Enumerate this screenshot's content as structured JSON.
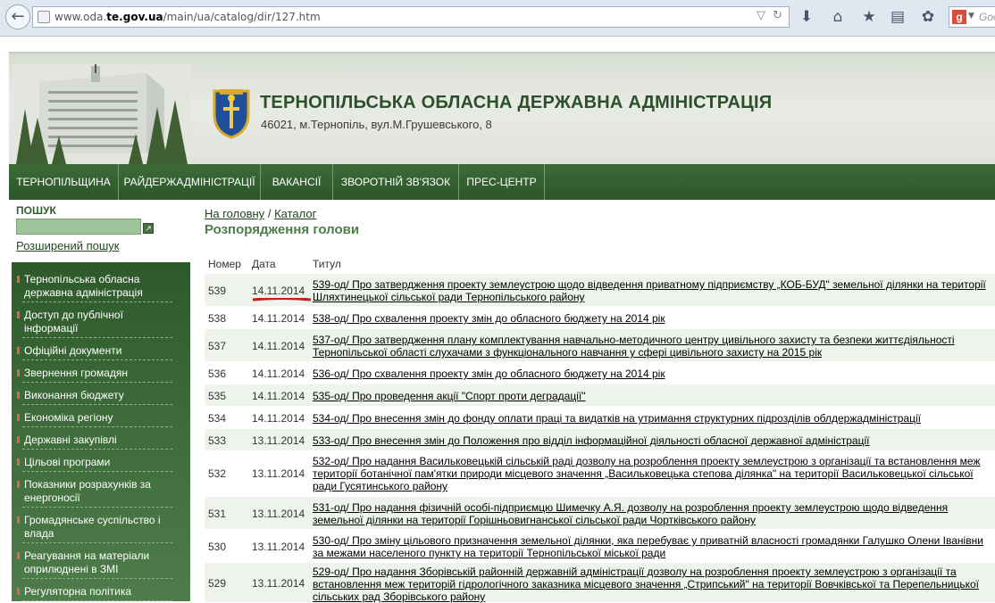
{
  "browser": {
    "url_prefix": "www.oda.",
    "url_domain": "te.gov.ua",
    "url_path": "/main/ua/catalog/dir/127.htm",
    "search_placeholder": "Goo",
    "accent_color": "#dd4b39"
  },
  "header": {
    "title": "ТЕРНОПІЛЬСЬКА ОБЛАСНА ДЕРЖАВНА АДМІНІСТРАЦІЯ",
    "address": "46021, м.Тернопіль, вул.М.Грушевського, 8",
    "brand_color": "#2d5629"
  },
  "menu": [
    {
      "label": "ТЕРНОПІЛЬЩИНА"
    },
    {
      "label": "РАЙДЕРЖАДМІНІСТРАЦІЇ"
    },
    {
      "label": "ВАКАНСІЇ"
    },
    {
      "label": "ЗВОРОТНІЙ ЗВ'ЯЗОК"
    },
    {
      "label": "ПРЕС-ЦЕНТР"
    }
  ],
  "sidebar": {
    "search_label": "ПОШУК",
    "advanced_search": "Розширений пошук",
    "items": [
      {
        "label": "Тернопільська обласна державна адміністрація"
      },
      {
        "label": "Доступ до публічної інформації"
      },
      {
        "label": "Офіційні документи"
      },
      {
        "label": "Звернення громадян"
      },
      {
        "label": "Виконання бюджету"
      },
      {
        "label": "Економіка регіону"
      },
      {
        "label": "Державні закупівлі"
      },
      {
        "label": "Цільові програми"
      },
      {
        "label": "Показники розрахунків за енергоносії"
      },
      {
        "label": "Громадянське суспільство і влада"
      },
      {
        "label": "Реагування на матеріали оприлюднені в ЗМІ"
      },
      {
        "label": "Регуляторна політика"
      }
    ]
  },
  "breadcrumb": {
    "home": "На головну",
    "separator": "/",
    "catalog": "Каталог"
  },
  "page_title": "Розпорядження голови",
  "table": {
    "columns": [
      "Номер",
      "Дата",
      "Титул"
    ],
    "rows": [
      {
        "num": "539",
        "date": "14.11.2014",
        "title": "539-од/ Про затвердження проекту землеустрою щодо відведення приватному підприємству „КОБ-БУД\" земельної ділянки на території Шляхтинецької сільської ради Тернопільського району"
      },
      {
        "num": "538",
        "date": "14.11.2014",
        "title": "538-од/ Про схвалення проекту змін до обласного бюджету на 2014 рік"
      },
      {
        "num": "537",
        "date": "14.11.2014",
        "title": "537-од/ Про затвердження плану комплектування навчально-методичного центру цивільного захисту та безпеки життєдіяльності Тернопільської області слухачами з функціонального навчання у сфері цивільного захисту на 2015 рік"
      },
      {
        "num": "536",
        "date": "14.11.2014",
        "title": "536-од/ Про схвалення проекту змін до обласного бюджету на 2014 рік"
      },
      {
        "num": "535",
        "date": "14.11.2014",
        "title": "535-од/ Про проведення акції \"Спорт проти деградації\""
      },
      {
        "num": "534",
        "date": "14.11.2014",
        "title": "534-од/ Про внесення змін до фонду оплати праці та видатків на утримання структурних підрозділів облдержадміністрації"
      },
      {
        "num": "533",
        "date": "13.11.2014",
        "title": "533-од/ Про внесення змін до Положення про відділ інформаційної діяльності обласної державної адміністрації"
      },
      {
        "num": "532",
        "date": "13.11.2014",
        "title": "532-од/ Про надання Васильковецькій сільській раді дозволу на розроблення проекту землеустрою з організації та встановлення меж території ботанічної пам'ятки природи місцевого значення „Васильковецька степова ділянка\" на території Васильковецької сільської ради Гусятинського району"
      },
      {
        "num": "531",
        "date": "13.11.2014",
        "title": "531-од/ Про надання фізичній особі-підприємцю Шимечку А.Я. дозволу на розроблення проекту землеустрою щодо відведення земельної ділянки на території Горішньовигнанської сільської ради Чортківського району"
      },
      {
        "num": "530",
        "date": "13.11.2014",
        "title": "530-од/ Про зміну цільового призначення земельної ділянки, яка перебуває у приватній власності громадянки Галушко Олени Іванівни за межами населеного пункту на території Тернопільської міської ради"
      },
      {
        "num": "529",
        "date": "13.11.2014",
        "title": "529-од/ Про надання Зборівській районній державній адміністрації дозволу на розроблення проекту землеустрою з організації та встановлення меж територій гідрологічного заказника місцевого значення „Стрипський\" на території Вовчківської та Перепельницької сільських рад Зборівського району"
      }
    ]
  }
}
